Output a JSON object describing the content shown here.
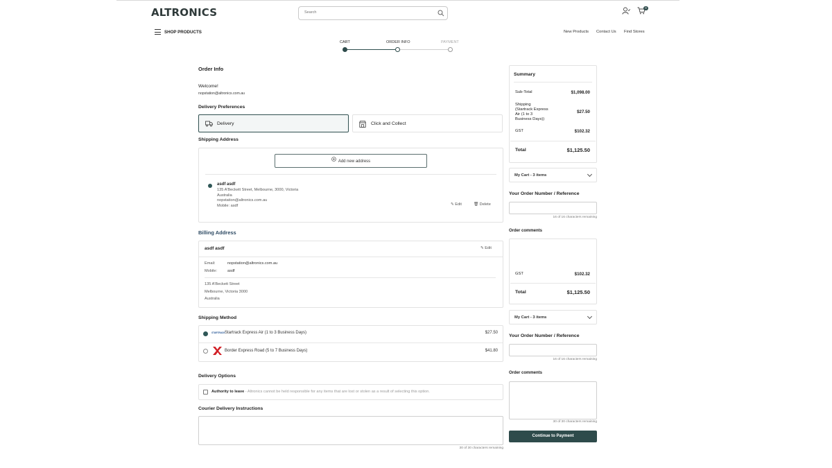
{
  "header": {
    "logo": "ALTRONICS",
    "search_placeholder": "Search",
    "cart_count": "0",
    "shop_products": "SHOP PRODUCTS",
    "nav": [
      "New Products",
      "Contact Us",
      "Find Stores"
    ]
  },
  "steps": [
    "CART",
    "ORDER INFO",
    "PAYMENT"
  ],
  "order_info": {
    "title": "Order Info",
    "welcome": "Welcome!",
    "email": "nopstation@altronics.com.au"
  },
  "delivery_preferences": {
    "title": "Delivery Preferences",
    "options": [
      "Delivery",
      "Click and Collect"
    ]
  },
  "shipping_address": {
    "title": "Shipping Address",
    "add_new": "Add new address",
    "name": "asdf asdf",
    "street": "135 A'Beckett Street, Melbourne, 3000, Victoria",
    "country": "Australia",
    "email": "nopstation@altronics.com.au",
    "mobile": "Mobile: asdf",
    "edit": "Edit",
    "delete": "Delete"
  },
  "billing_address": {
    "title": "Billing Address",
    "name": "asdf asdf",
    "edit": "Edit",
    "email_label": "Email:",
    "email_value": "nopstation@altronics.com.au",
    "mobile_label": "Mobile:",
    "mobile_value": "asdf",
    "line1": "135 A'Beckett Street",
    "line2": "Melbourne, Victoria 3000",
    "line3": "Australia"
  },
  "shipping_method": {
    "title": "Shipping Method",
    "methods": [
      {
        "name": "Startrack Express Air (1 to 3 Business Days)",
        "price": "$27.50",
        "selected": true,
        "logo": "STARTRACK"
      },
      {
        "name": "Border Express Road (5 to 7 Business Days)",
        "price": "$41.80",
        "selected": false
      }
    ]
  },
  "delivery_options": {
    "title": "Delivery Options",
    "authority_label": "Authority to leave",
    "authority_note": " - Altronics cannot be held responsible for any items that are lost or stolen as a result of selecting this option."
  },
  "courier": {
    "title": "Courier Delivery Instructions",
    "remaining": "30 of 30 characters remaining"
  },
  "summary": {
    "title": "Summary",
    "subtotal_label": "Sub-Total",
    "subtotal_value": "$1,098.00",
    "shipping_label": "Shipping\n(Startrack Express\nAir (1 to 3\nBusiness Days))",
    "shipping_value": "$27.50",
    "gst_label": "GST",
    "gst_value": "$102.32",
    "total_label": "Total",
    "total_value": "$1,125.50"
  },
  "sidebar": {
    "my_cart": "My Cart - 3 items",
    "order_number_title": "Your Order Number / Reference",
    "order_number_remaining": "16 of 16 characters remaining",
    "order_comments_title": "Order comments",
    "gst_label": "GST",
    "gst_value": "$102.32",
    "total_label": "Total",
    "total_value": "$1,125.50",
    "my_cart_2": "My Cart - 3 items",
    "order_number_title_2": "Your Order Number / Reference",
    "order_number_remaining_2": "16 of 16 characters remaining",
    "order_comments_title_2": "Order comments",
    "comments_remaining": "30 of 30 characters remaining",
    "continue": "Continue to Payment"
  },
  "colors": {
    "accent": "#2e4b4b",
    "border": "#e2e2e2",
    "border_express_red": "#d21f26",
    "startrack_blue": "#1d4f91"
  }
}
